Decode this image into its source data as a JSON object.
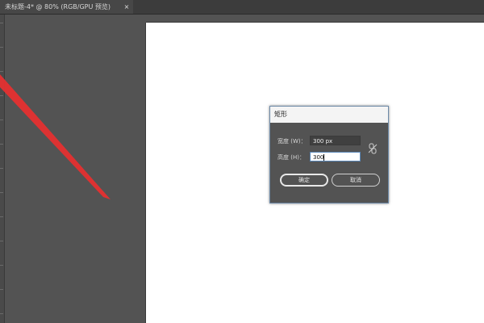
{
  "document_tab": {
    "title": "未标题-4* @ 80% (RGB/GPU 预览)",
    "close_symbol": "×"
  },
  "dialog": {
    "title": "矩形",
    "width_label": "宽度 (W)：",
    "width_value": "300 px",
    "height_label": "高度 (H)：",
    "height_value": "300",
    "link_icon": "chain-link-icon",
    "ok_label": "确定",
    "cancel_label": "取消"
  },
  "colors": {
    "workspace": "#535353",
    "artboard": "#ffffff",
    "annotation": "#e53030",
    "dialog_border": "#6d8aa8"
  }
}
